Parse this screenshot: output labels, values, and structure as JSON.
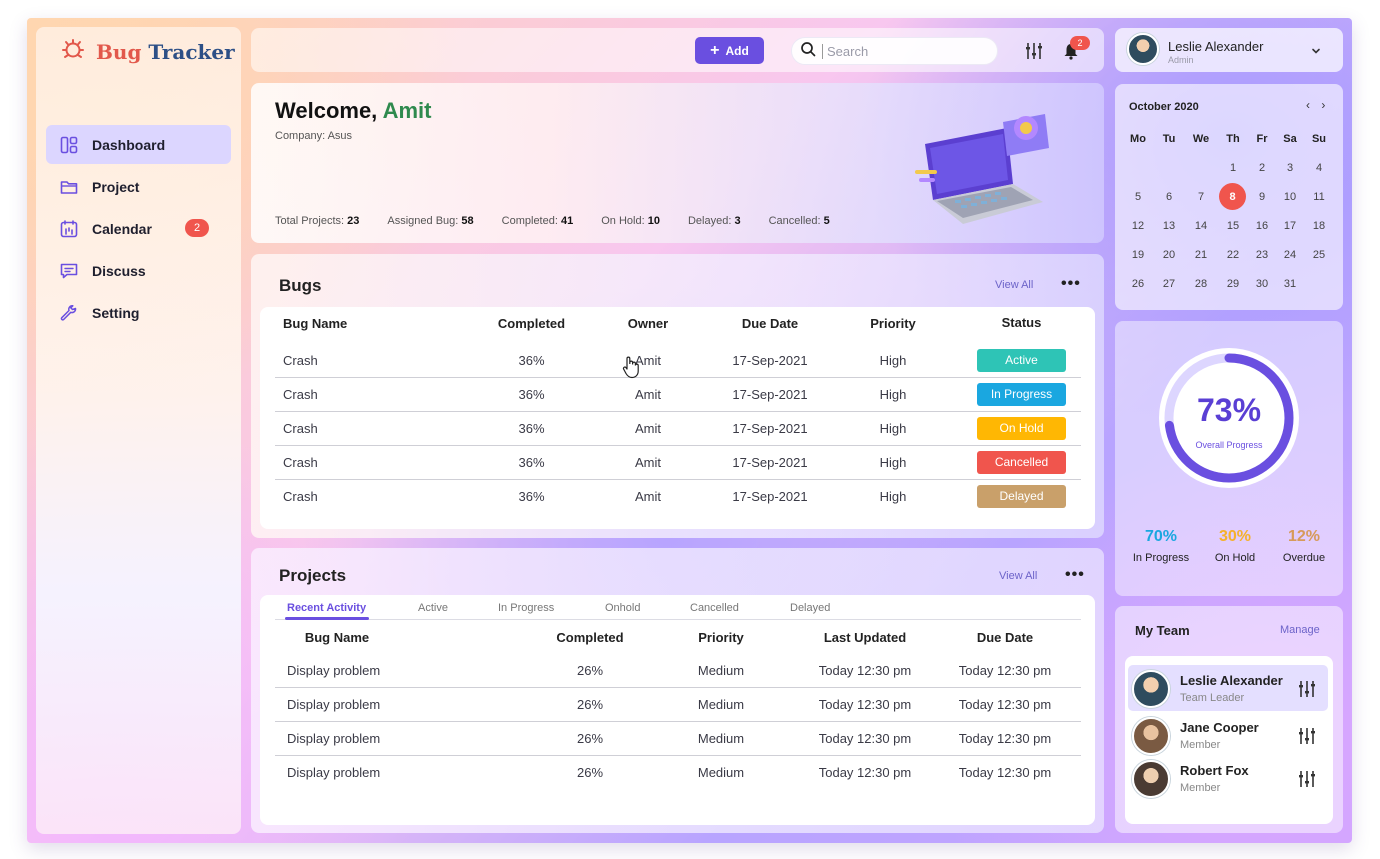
{
  "app": {
    "logo_word1": "Bug",
    "logo_word2": "Tracker"
  },
  "sidebar": {
    "items": [
      {
        "label": "Dashboard",
        "icon": "dashboard-icon"
      },
      {
        "label": "Project",
        "icon": "folder-icon"
      },
      {
        "label": "Calendar",
        "icon": "calendar-icon",
        "badge": "2"
      },
      {
        "label": "Discuss",
        "icon": "chat-icon"
      },
      {
        "label": "Setting",
        "icon": "wrench-icon"
      }
    ]
  },
  "topbar": {
    "add_label": "Add",
    "search_placeholder": "Search",
    "notification_count": "2"
  },
  "user": {
    "name": "Leslie Alexander",
    "role": "Admin"
  },
  "welcome": {
    "greeting": "Welcome,",
    "name": "Amit",
    "company": "Company: Asus",
    "stats": [
      {
        "label": "Total Projects:",
        "value": "23"
      },
      {
        "label": "Assigned Bug:",
        "value": "58"
      },
      {
        "label": "Completed:",
        "value": "41"
      },
      {
        "label": "On Hold:",
        "value": "10"
      },
      {
        "label": "Delayed:",
        "value": "3"
      },
      {
        "label": "Cancelled:",
        "value": "5"
      }
    ]
  },
  "bugs": {
    "title": "Bugs",
    "view_all": "View All",
    "more": "•••",
    "columns": [
      "Bug Name",
      "Completed",
      "Owner",
      "Due Date",
      "Priority",
      "Status"
    ],
    "rows": [
      {
        "name": "Crash",
        "completed": "36%",
        "owner": "Amit",
        "due": "17-Sep-2021",
        "priority": "High",
        "status": "Active",
        "status_color": "#2ec4b6"
      },
      {
        "name": "Crash",
        "completed": "36%",
        "owner": "Amit",
        "due": "17-Sep-2021",
        "priority": "High",
        "status": "In Progress",
        "status_color": "#1aa7e0"
      },
      {
        "name": "Crash",
        "completed": "36%",
        "owner": "Amit",
        "due": "17-Sep-2021",
        "priority": "High",
        "status": "On Hold",
        "status_color": "#ffb703"
      },
      {
        "name": "Crash",
        "completed": "36%",
        "owner": "Amit",
        "due": "17-Sep-2021",
        "priority": "High",
        "status": "Cancelled",
        "status_color": "#f0554d"
      },
      {
        "name": "Crash",
        "completed": "36%",
        "owner": "Amit",
        "due": "17-Sep-2021",
        "priority": "High",
        "status": "Delayed",
        "status_color": "#c9a06a"
      }
    ]
  },
  "projects": {
    "title": "Projects",
    "view_all": "View All",
    "more": "•••",
    "tabs": [
      "Recent Activity",
      "Active",
      "In Progress",
      "Onhold",
      "Cancelled",
      "Delayed"
    ],
    "active_tab": "Recent Activity",
    "columns": [
      "Bug Name",
      "Completed",
      "Priority",
      "Last Updated",
      "Due Date"
    ],
    "rows": [
      {
        "name": "Display problem",
        "completed": "26%",
        "priority": "Medium",
        "updated": "Today 12:30 pm",
        "due": "Today 12:30 pm"
      },
      {
        "name": "Display problem",
        "completed": "26%",
        "priority": "Medium",
        "updated": "Today 12:30 pm",
        "due": "Today 12:30 pm"
      },
      {
        "name": "Display problem",
        "completed": "26%",
        "priority": "Medium",
        "updated": "Today 12:30 pm",
        "due": "Today 12:30 pm"
      },
      {
        "name": "Display problem",
        "completed": "26%",
        "priority": "Medium",
        "updated": "Today 12:30 pm",
        "due": "Today 12:30 pm"
      }
    ]
  },
  "calendar": {
    "title": "October 2020",
    "prev": "‹",
    "next": "›",
    "weekdays": [
      "Mo",
      "Tu",
      "We",
      "Th",
      "Fr",
      "Sa",
      "Su"
    ],
    "weeks": [
      [
        "",
        "",
        "",
        "1",
        "2",
        "3",
        "4"
      ],
      [
        "5",
        "6",
        "7",
        "8",
        "9",
        "10",
        "11"
      ],
      [
        "12",
        "13",
        "14",
        "15",
        "16",
        "17",
        "18"
      ],
      [
        "19",
        "20",
        "21",
        "22",
        "23",
        "24",
        "25"
      ],
      [
        "26",
        "27",
        "28",
        "29",
        "30",
        "31",
        ""
      ]
    ],
    "selected": "8"
  },
  "progress": {
    "percent": "73%",
    "percent_value": 0.73,
    "label": "Overall Progress",
    "breakdown": [
      {
        "value": "70%",
        "label": "In Progress",
        "color": "#1aa7e0"
      },
      {
        "value": "30%",
        "label": "On Hold",
        "color": "#f5b12b"
      },
      {
        "value": "12%",
        "label": "Overdue",
        "color": "#d79a5a"
      }
    ]
  },
  "team": {
    "title": "My Team",
    "manage": "Manage",
    "members": [
      {
        "name": "Leslie Alexander",
        "role": "Team Leader"
      },
      {
        "name": "Jane Cooper",
        "role": "Member"
      },
      {
        "name": "Robert Fox",
        "role": "Member"
      }
    ]
  },
  "colors": {
    "accent": "#6a4fe0",
    "danger": "#f0554d",
    "welcome_name": "#2f8a4e"
  }
}
